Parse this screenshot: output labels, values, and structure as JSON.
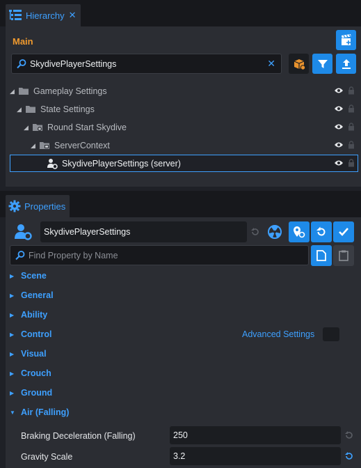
{
  "hierarchy": {
    "tab_label": "Hierarchy",
    "tab_close": "✕",
    "root_label": "Main",
    "search_value": "SkydivePlayerSettings",
    "search_clear": "✕",
    "tree": [
      {
        "label": "Gameplay Settings",
        "depth": 0,
        "icon": "folder-icon"
      },
      {
        "label": "State Settings",
        "depth": 1,
        "icon": "folder-icon"
      },
      {
        "label": "Round Start Skydive",
        "depth": 2,
        "icon": "folder-network-icon"
      },
      {
        "label": "ServerContext",
        "depth": 3,
        "icon": "context-folder-icon"
      },
      {
        "label": "SkydivePlayerSettings (server)",
        "depth": 4,
        "icon": "player-settings-icon",
        "selected": true
      }
    ]
  },
  "properties": {
    "tab_label": "Properties",
    "object_name": "SkydivePlayerSettings",
    "find_placeholder": "Find Property by Name",
    "sections": [
      {
        "label": "Scene",
        "expanded": false
      },
      {
        "label": "General",
        "expanded": false
      },
      {
        "label": "Ability",
        "expanded": false
      },
      {
        "label": "Control",
        "expanded": false
      },
      {
        "label": "Visual",
        "expanded": false
      },
      {
        "label": "Crouch",
        "expanded": false
      },
      {
        "label": "Ground",
        "expanded": false
      },
      {
        "label": "Air (Falling)",
        "expanded": true
      }
    ],
    "advanced_settings_label": "Advanced Settings",
    "props": [
      {
        "label": "Braking Deceleration (Falling)",
        "value": "250"
      },
      {
        "label": "Gravity Scale",
        "value": "3.2"
      }
    ]
  },
  "colors": {
    "accent": "#3ea0ff",
    "root_label": "#f09a2e",
    "button_blue": "#1e8ae8",
    "panel_bg": "#2b2d33"
  }
}
